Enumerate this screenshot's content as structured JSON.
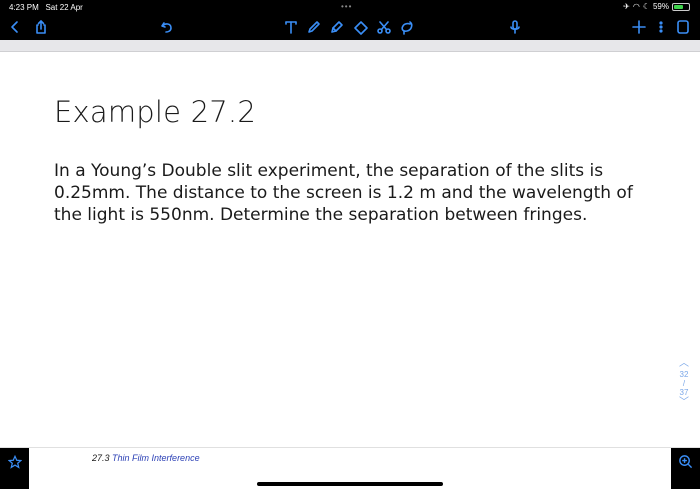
{
  "status_bar": {
    "time": "4:23 PM",
    "date": "Sat 22 Apr",
    "battery": "59%",
    "battery_level": 0.59,
    "more_dots": "•••"
  },
  "toolbar": {
    "icons": [
      "back-icon",
      "share-icon",
      "undo-icon",
      "text-tool-icon",
      "pen-icon",
      "highlighter-icon",
      "eraser-icon",
      "scissors-icon",
      "lasso-icon",
      "microphone-icon",
      "add-icon",
      "more-icon",
      "page-view-icon"
    ],
    "accent_color": "#3a8ef6"
  },
  "slide": {
    "title": "Example 27.2",
    "body": "In a Young’s Double slit experiment, the separation of the slits is 0.25mm. The distance to the screen is 1.2 m and the wavelength of the light is 550nm. Determine the separation between fringes."
  },
  "page_nav": {
    "current": "32",
    "separator": "/",
    "total": "37"
  },
  "footer": {
    "section_number": "27.3",
    "section_title": "Thin Film Interference"
  }
}
